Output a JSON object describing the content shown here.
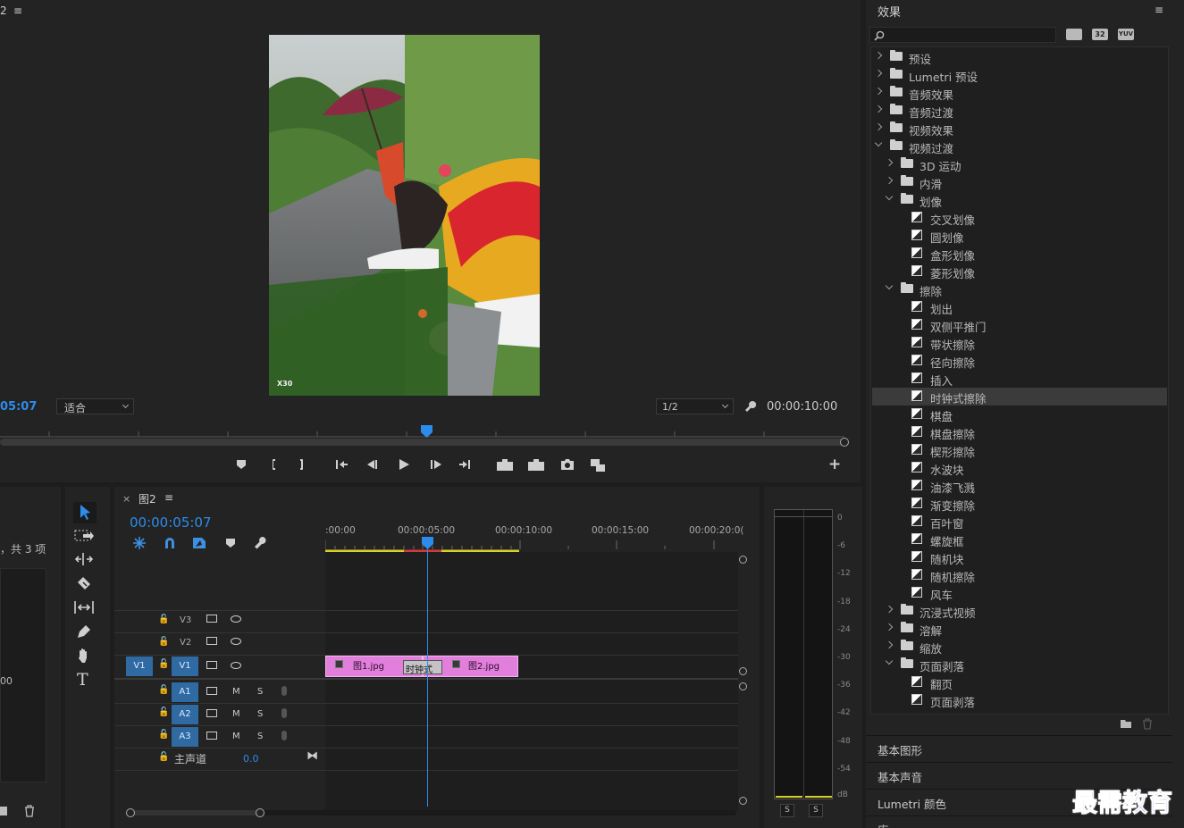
{
  "program": {
    "tab_fragment": "2",
    "timecode_left": "05:07",
    "fit_value": "适合",
    "resolution_value": "1/2",
    "duration": "00:00:10:00",
    "preview_watermark": "X30"
  },
  "project": {
    "items_label": "，共 3 项",
    "zoom_fragment": "00"
  },
  "timeline": {
    "sequence_name": "图2",
    "timecode": "00:00:05:07",
    "ruler": [
      ":00:00",
      "00:00:05:00",
      "00:00:10:00",
      "00:00:15:00",
      "00:00:20:0("
    ],
    "tracks_video": [
      {
        "label": "V3",
        "source": ""
      },
      {
        "label": "V2",
        "source": ""
      },
      {
        "label": "V1",
        "source": "V1"
      }
    ],
    "tracks_audio": [
      {
        "label": "A1",
        "m": "M",
        "s": "S"
      },
      {
        "label": "A2",
        "m": "M",
        "s": "S"
      },
      {
        "label": "A3",
        "m": "M",
        "s": "S"
      }
    ],
    "master_label": "主声道",
    "master_value": "0.0",
    "clips": [
      {
        "name": "图1.jpg"
      },
      {
        "name": "图2.jpg"
      }
    ],
    "transition_label": "时钟式"
  },
  "audio_meter": {
    "scale": [
      "0",
      "-6",
      "-12",
      "-18",
      "-24",
      "-30",
      "-36",
      "-42",
      "-48",
      "-54",
      "dB"
    ],
    "solo_left": "S",
    "solo_right": "S"
  },
  "effects": {
    "title": "效果",
    "search_placeholder": "",
    "tool_labels": [
      "32",
      "YUV"
    ],
    "tree": [
      {
        "label": "预设",
        "level": 0,
        "kind": "special",
        "state": "closed"
      },
      {
        "label": "Lumetri 预设",
        "level": 0,
        "kind": "special",
        "state": "closed"
      },
      {
        "label": "音频效果",
        "level": 0,
        "kind": "folder",
        "state": "closed"
      },
      {
        "label": "音频过渡",
        "level": 0,
        "kind": "folder",
        "state": "closed"
      },
      {
        "label": "视频效果",
        "level": 0,
        "kind": "folder",
        "state": "closed"
      },
      {
        "label": "视频过渡",
        "level": 0,
        "kind": "folder",
        "state": "open"
      },
      {
        "label": "3D 运动",
        "level": 1,
        "kind": "folder",
        "state": "closed"
      },
      {
        "label": "内滑",
        "level": 1,
        "kind": "folder",
        "state": "closed"
      },
      {
        "label": "划像",
        "level": 1,
        "kind": "folder",
        "state": "open"
      },
      {
        "label": "交叉划像",
        "level": 2,
        "kind": "fx"
      },
      {
        "label": "圆划像",
        "level": 2,
        "kind": "fx"
      },
      {
        "label": "盒形划像",
        "level": 2,
        "kind": "fx"
      },
      {
        "label": "菱形划像",
        "level": 2,
        "kind": "fx"
      },
      {
        "label": "擦除",
        "level": 1,
        "kind": "folder",
        "state": "open"
      },
      {
        "label": "划出",
        "level": 2,
        "kind": "fx"
      },
      {
        "label": "双侧平推门",
        "level": 2,
        "kind": "fx"
      },
      {
        "label": "带状擦除",
        "level": 2,
        "kind": "fx"
      },
      {
        "label": "径向擦除",
        "level": 2,
        "kind": "fx"
      },
      {
        "label": "插入",
        "level": 2,
        "kind": "fx"
      },
      {
        "label": "时钟式擦除",
        "level": 2,
        "kind": "fx",
        "selected": true
      },
      {
        "label": "棋盘",
        "level": 2,
        "kind": "fx"
      },
      {
        "label": "棋盘擦除",
        "level": 2,
        "kind": "fx"
      },
      {
        "label": "楔形擦除",
        "level": 2,
        "kind": "fx"
      },
      {
        "label": "水波块",
        "level": 2,
        "kind": "fx"
      },
      {
        "label": "油漆飞溅",
        "level": 2,
        "kind": "fx"
      },
      {
        "label": "渐变擦除",
        "level": 2,
        "kind": "fx"
      },
      {
        "label": "百叶窗",
        "level": 2,
        "kind": "fx"
      },
      {
        "label": "螺旋框",
        "level": 2,
        "kind": "fx"
      },
      {
        "label": "随机块",
        "level": 2,
        "kind": "fx"
      },
      {
        "label": "随机擦除",
        "level": 2,
        "kind": "fx"
      },
      {
        "label": "风车",
        "level": 2,
        "kind": "fx"
      },
      {
        "label": "沉浸式视频",
        "level": 1,
        "kind": "folder",
        "state": "closed"
      },
      {
        "label": "溶解",
        "level": 1,
        "kind": "folder",
        "state": "closed"
      },
      {
        "label": "缩放",
        "level": 1,
        "kind": "folder",
        "state": "closed"
      },
      {
        "label": "页面剥落",
        "level": 1,
        "kind": "folder",
        "state": "open"
      },
      {
        "label": "翻页",
        "level": 2,
        "kind": "fx"
      },
      {
        "label": "页面剥落",
        "level": 2,
        "kind": "fx"
      }
    ],
    "panels": [
      "基本图形",
      "基本声音",
      "Lumetri 颜色",
      "库"
    ]
  },
  "watermark": "最需教育",
  "colors": {
    "accent_blue": "#2d8ceb",
    "clip_pink": "#e27fdc",
    "selected_track": "#2f6aa3",
    "work_area_yellow": "#d8cf2a"
  }
}
